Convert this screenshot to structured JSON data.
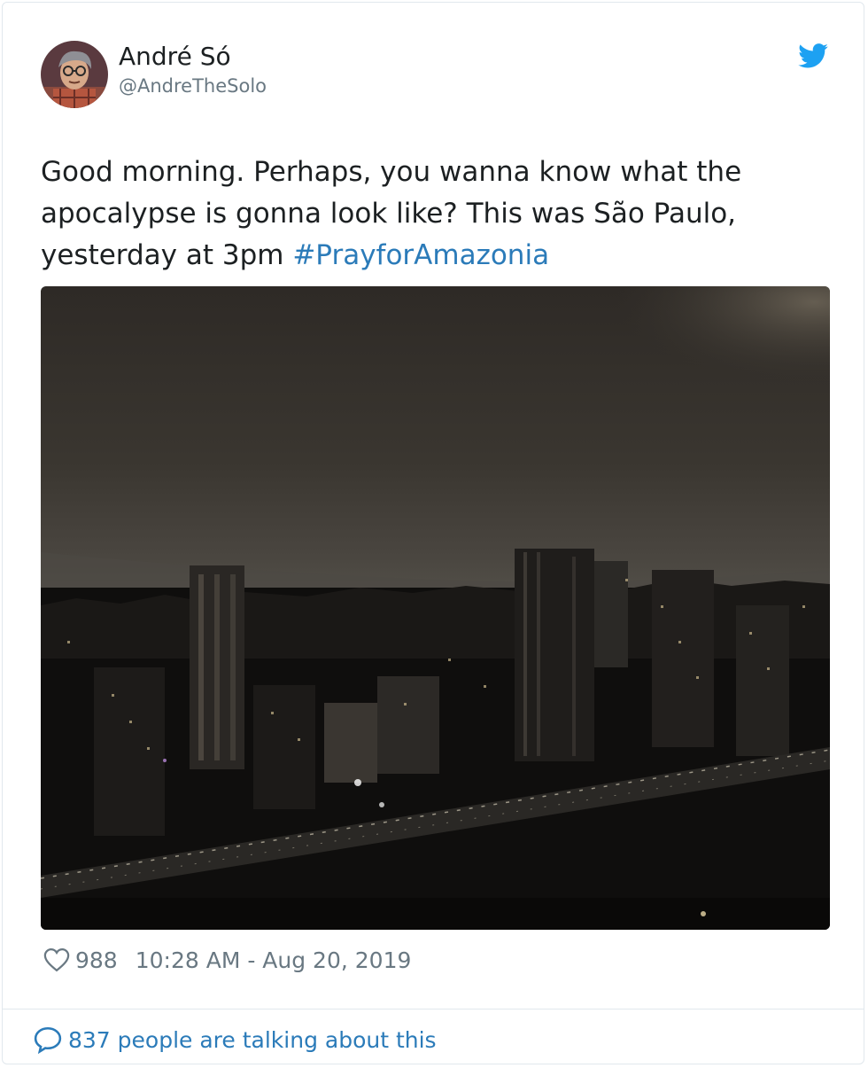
{
  "author": {
    "name": "André Só",
    "handle": "@AndreTheSolo",
    "avatar_icon": "avatar-illustration"
  },
  "brand": {
    "icon": "twitter-bird-icon",
    "color": "#1da1f2"
  },
  "tweet": {
    "line1": "Good morning. Perhaps, you wanna know what the",
    "line2": "apocalypse is gonna look like? This was São Paulo,",
    "line3_text": "yesterday at 3pm ",
    "hashtag": "#PrayforAmazonia"
  },
  "media": {
    "icon": "photo-dark-city-skyline"
  },
  "meta": {
    "like_icon": "heart-icon",
    "like_count": "988",
    "timestamp": "10:28 AM - Aug 20, 2019"
  },
  "footer": {
    "icon": "speech-bubble-icon",
    "talking_text": "837 people are talking about this"
  },
  "colors": {
    "text": "#1c2022",
    "secondary": "#697882",
    "link": "#2b7bb9",
    "border": "#e1e8ed"
  }
}
